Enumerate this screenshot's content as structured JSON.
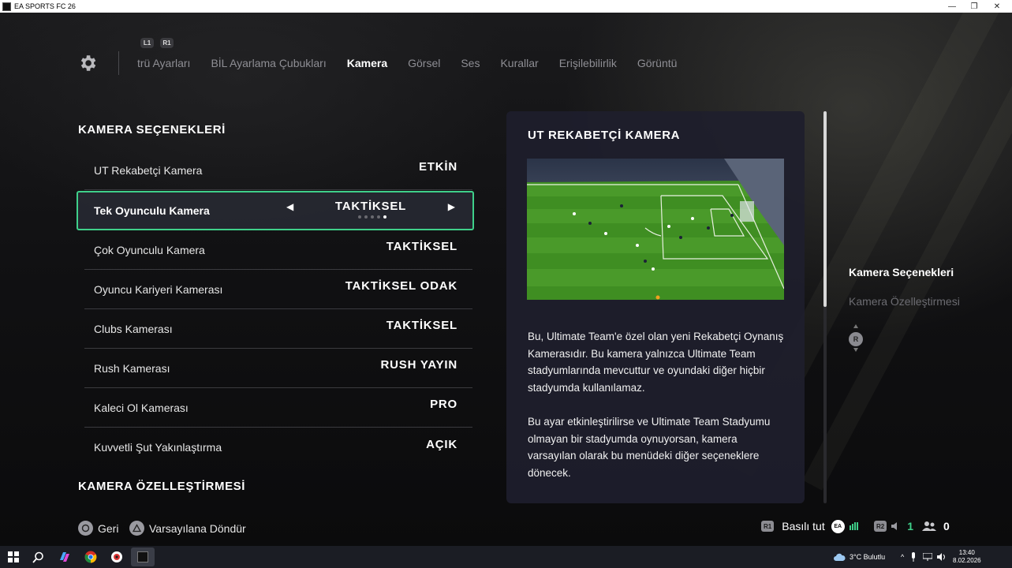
{
  "window": {
    "title": "EA SPORTS FC 26",
    "minimize": "—",
    "restore": "❐",
    "close": "✕"
  },
  "nav": {
    "bumpers": {
      "left": "L1",
      "right": "R1"
    },
    "tabs": [
      {
        "label": "trü Ayarları",
        "active": false
      },
      {
        "label": "BİL Ayarlama Çubukları",
        "active": false
      },
      {
        "label": "Kamera",
        "active": true
      },
      {
        "label": "Görsel",
        "active": false
      },
      {
        "label": "Ses",
        "active": false
      },
      {
        "label": "Kurallar",
        "active": false
      },
      {
        "label": "Erişilebilirlik",
        "active": false
      },
      {
        "label": "Görüntü",
        "active": false
      }
    ]
  },
  "sections": {
    "camera_options": "KAMERA SEÇENEKLERİ",
    "camera_custom": "KAMERA ÖZELLEŞTİRMESİ"
  },
  "settings": [
    {
      "label": "UT Rekabetçi Kamera",
      "value": "ETKİN"
    },
    {
      "label": "Tek Oyunculu Kamera",
      "value": "TAKTİKSEL",
      "selected": true,
      "option_count": 5,
      "option_index": 4
    },
    {
      "label": "Çok Oyunculu Kamera",
      "value": "TAKTİKSEL"
    },
    {
      "label": "Oyuncu Kariyeri Kamerası",
      "value": "TAKTİKSEL ODAK"
    },
    {
      "label": "Clubs Kamerası",
      "value": "TAKTİKSEL"
    },
    {
      "label": "Rush Kamerası",
      "value": "RUSH YAYIN"
    },
    {
      "label": "Kaleci Ol Kamerası",
      "value": "PRO"
    },
    {
      "label": "Kuvvetli Şut Yakınlaştırma",
      "value": "AÇIK"
    }
  ],
  "selector": {
    "left_arrow": "◀",
    "right_arrow": "▶"
  },
  "panel": {
    "title": "UT REKABETÇİ KAMERA",
    "paragraph1": "Bu, Ultimate Team'e özel olan yeni Rekabetçi Oynanış Kamerasıdır. Bu kamera yalnızca Ultimate Team stadyumlarında mevcuttur ve oyundaki diğer hiçbir stadyumda kullanılamaz.",
    "paragraph2": "Bu ayar etkinleştirilirse ve Ultimate Team Stadyumu olmayan bir stadyumda oynuyorsan, kamera varsayılan olarak bu menüdeki diğer seçeneklere dönecek."
  },
  "side_nav": {
    "items": [
      {
        "label": "Kamera Seçenekleri",
        "active": true
      },
      {
        "label": "Kamera Özelleştirmesi",
        "active": false
      }
    ],
    "stick_label": "R"
  },
  "hints": {
    "back": "Geri",
    "reset": "Varsayılana Döndür"
  },
  "status": {
    "r1_chip": "R1",
    "hold": "Basılı tut",
    "ea_badge": "EA",
    "r2_chip": "R2",
    "voice_count": "1",
    "friends_count": "0"
  },
  "taskbar": {
    "weather": "3°C  Bulutlu",
    "time": "13:40",
    "date": "8.02.2026",
    "pinned": [
      "start-icon",
      "search-icon",
      "copilot-icon",
      "chrome-icon",
      "app-icon",
      "ea-fc-icon"
    ]
  },
  "colors": {
    "accent_green": "#3fd08a",
    "panel_bg": "#1e1e2c"
  }
}
